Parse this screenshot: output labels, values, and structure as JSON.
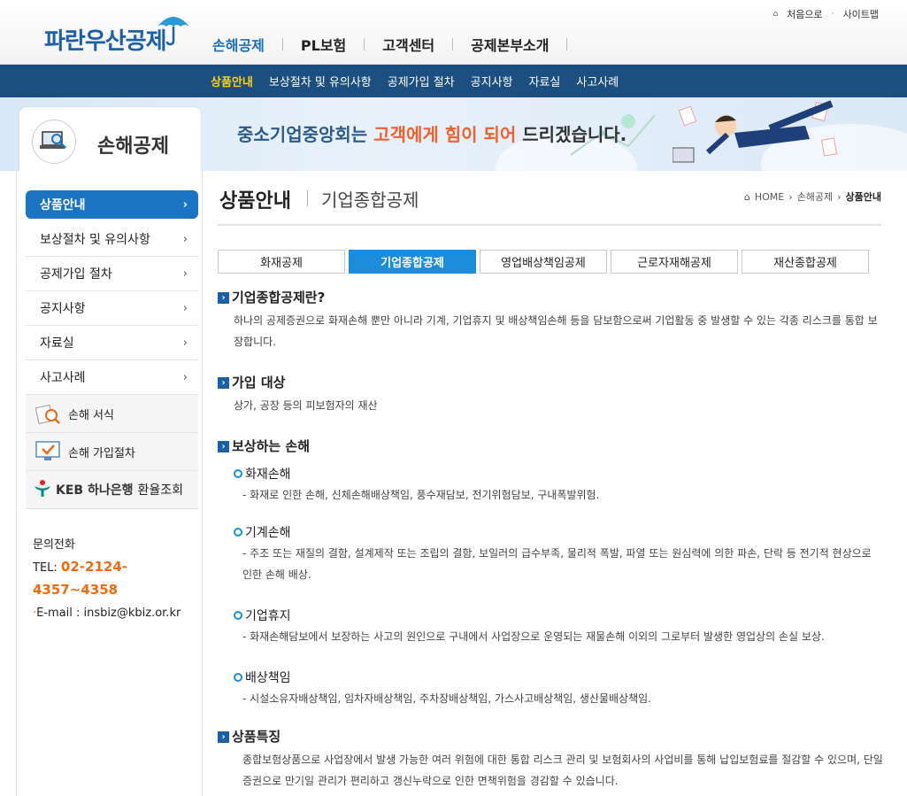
{
  "header": {
    "logo_text": "파란우산공제",
    "util_links": [
      "처음으로",
      "사이트맵"
    ],
    "gnb": [
      "손해공제",
      "PL보험",
      "고객센터",
      "공제본부소개"
    ]
  },
  "subnav": {
    "items": [
      "상품안내",
      "보상절차 및 유의사항",
      "공제가입 절차",
      "공지사항",
      "자료실",
      "사고사례"
    ],
    "active": "상품안내"
  },
  "banner": {
    "section_title": "손해공제",
    "slogan_part1": "중소기업중앙회는 ",
    "slogan_highlight": "고객에게 힘이 되어",
    "slogan_part2": " 드리겠습니다."
  },
  "sidebar": {
    "items": [
      "상품안내",
      "보상절차 및 유의사항",
      "공제가입 절차",
      "공지사항",
      "자료실",
      "사고사례"
    ],
    "quick": [
      "손해 서식",
      "손해 가입절차"
    ],
    "keb_brand": "KEB 하나은행",
    "keb_label": "환율조회",
    "contact_title": "문의전화",
    "tel_label": "TEL: ",
    "tel": "02-2124-4357~4358",
    "email": "E-mail : insbiz@kbiz.or.kr"
  },
  "page": {
    "title": "상품안내",
    "subtitle": "기업종합공제",
    "breadcrumb": [
      "HOME",
      "손해공제",
      "상품안내"
    ]
  },
  "tabs": [
    "화재공제",
    "기업종합공제",
    "영업배상책임공제",
    "근로자재해공제",
    "재산종합공제"
  ],
  "active_tab": "기업종합공제",
  "sections": {
    "s1_title": "기업종합공제란?",
    "s1_text": "하나의 공제증권으로 화재손해 뿐만 아니라 기계, 기업휴지 및 배상책임손해 등을 담보함으로써 기업활동 중 발생할 수 있는 각종 리스크를 통합 보장합니다.",
    "s2_title": "가입 대상",
    "s2_text": "상가, 공장 등의 피보험자의 재산",
    "s3_title": "보상하는 손해",
    "s3_items": [
      {
        "title": "화재손해",
        "desc": "- 화재로 인한 손해, 신체손해배상책임, 풍수재담보, 전기위험담보, 구내폭발위험."
      },
      {
        "title": "기계손해",
        "desc": "- 주조 또는 재질의 결함, 설계제작 또는 조립의 결함, 보일러의 급수부족, 물리적 폭발, 파열 또는 원심력에 의한 파손, 단락 등 전기적 현상으로 인한 손해 배상."
      },
      {
        "title": "기업휴지",
        "desc": "- 화재손해담보에서 보장하는 사고의 원인으로 구내에서 사업장으로 운영되는 재물손해 이외의 그로부터 발생한 영업상의 손실 보상."
      },
      {
        "title": "배상책임",
        "desc": "- 시설소유자배상책임, 임차자배상책임, 주차장배상책임, 가스사고배상책임, 생산물배상책임."
      }
    ],
    "s4_title": "상품특징",
    "s4_text": "종합보험상품으로 사업장에서 발생 가능한 여러 위험에 대한 통합 리스크 관리 및 보험회사의 사업비를 통해 납입보험료를 절감할 수 있으며, 단일증권으로 만기일 관리가 편리하고 갱신누락으로 인한 면책위험을 경감할 수 있습니다."
  }
}
